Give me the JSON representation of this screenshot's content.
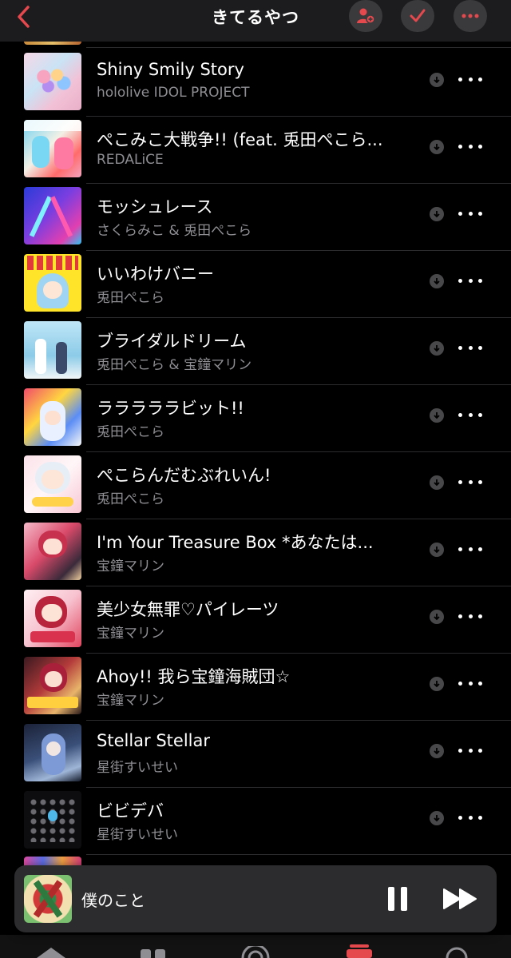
{
  "header": {
    "title": "きてるやつ",
    "accent": "#e5484d"
  },
  "tracks": [
    {
      "title": "Shiny Smily Story",
      "artist": "hololive IDOL PROJECT"
    },
    {
      "title": "ぺこみこ大戦争!! (feat. 兎田ぺこら...",
      "artist": "REDALiCE"
    },
    {
      "title": "モッシュレース",
      "artist": "さくらみこ & 兎田ぺこら"
    },
    {
      "title": "いいわけバニー",
      "artist": "兎田ぺこら"
    },
    {
      "title": "ブライダルドリーム",
      "artist": "兎田ぺこら & 宝鐘マリン"
    },
    {
      "title": "ラララララビット!!",
      "artist": "兎田ぺこら"
    },
    {
      "title": "ぺこらんだむぶれいん!",
      "artist": "兎田ぺこら"
    },
    {
      "title": "I'm Your Treasure Box *あなたは...",
      "artist": "宝鐘マリン"
    },
    {
      "title": "美少女無罪♡パイレーツ",
      "artist": "宝鐘マリン"
    },
    {
      "title": "Ahoy!! 我ら宝鐘海賊団☆",
      "artist": "宝鐘マリン"
    },
    {
      "title": "Stellar Stellar",
      "artist": "星街すいせい"
    },
    {
      "title": "ビビデバ",
      "artist": "星街すいせい"
    }
  ],
  "now_playing": {
    "title": "僕のこと"
  }
}
